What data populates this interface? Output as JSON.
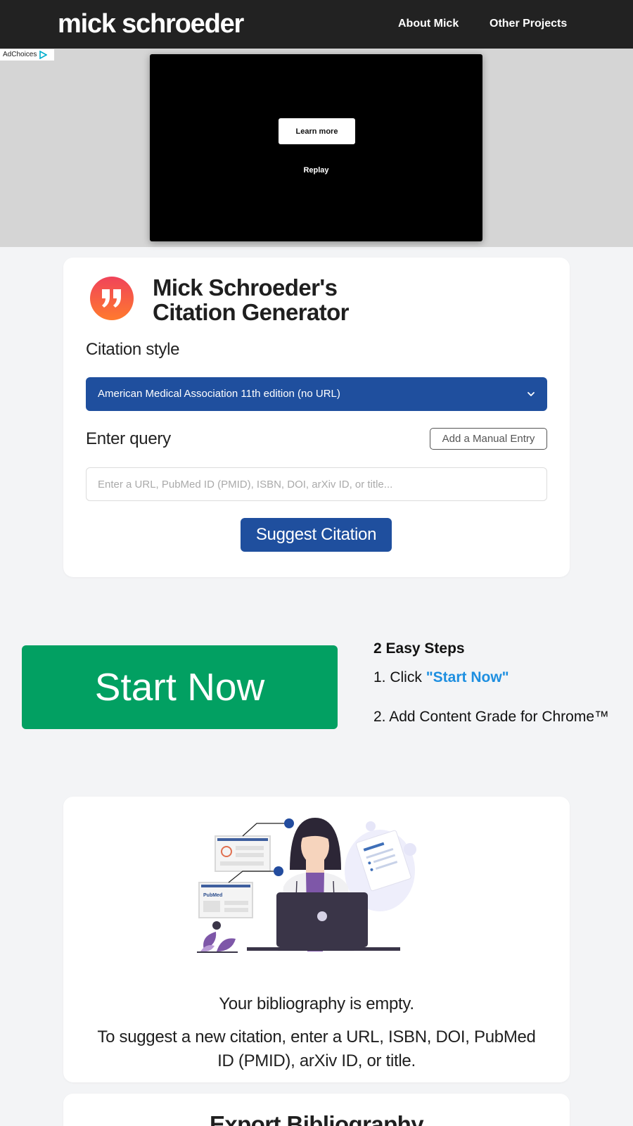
{
  "header": {
    "brand": "mick schroeder",
    "nav": [
      {
        "label": "About Mick"
      },
      {
        "label": "Other Projects"
      }
    ]
  },
  "ad": {
    "adchoices": "AdChoices",
    "learn_more": "Learn more",
    "replay": "Replay"
  },
  "generator": {
    "title_line1": "Mick Schroeder's",
    "title_line2": "Citation Generator",
    "style_label": "Citation style",
    "style_selected": "American Medical Association 11th edition (no URL)",
    "query_label": "Enter query",
    "manual_entry": "Add a Manual Entry",
    "query_placeholder": "Enter a URL, PubMed ID (PMID), ISBN, DOI, arXiv ID, or title...",
    "suggest_button": "Suggest Citation"
  },
  "promo": {
    "start_now": "Start Now",
    "steps_title": "2 Easy Steps",
    "step1_prefix": "1. Click ",
    "step1_link": "\"Start Now\"",
    "step2": "2. Add Content Grade for Chrome™"
  },
  "bibliography": {
    "pubmed_label": "PubMed",
    "empty_title": "Your bibliography is empty.",
    "empty_hint": "To suggest a new citation, enter a URL, ISBN, DOI, PubMed ID (PMID), arXiv ID, or title."
  },
  "export": {
    "title": "Export Bibliography"
  },
  "colors": {
    "header_bg": "#222222",
    "primary_blue": "#1f4f9e",
    "start_green": "#02a062",
    "link_blue": "#1e8fe0",
    "logo_gradient_top": "#f0435a",
    "logo_gradient_bottom": "#ff7a2e"
  }
}
